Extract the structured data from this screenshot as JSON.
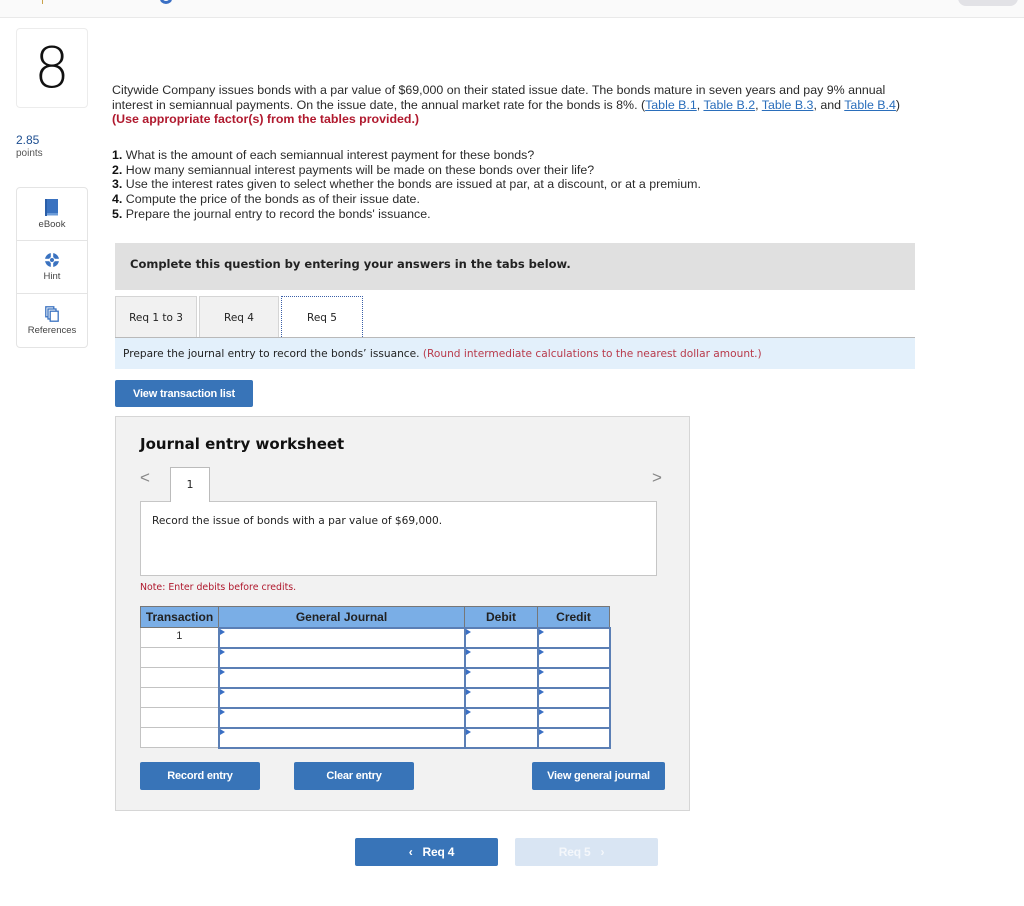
{
  "question": {
    "number": "8",
    "points_value": "2.85",
    "points_label": "points"
  },
  "tools": [
    {
      "icon": "book-icon",
      "label": "eBook"
    },
    {
      "icon": "lifebuoy-icon",
      "label": "Hint"
    },
    {
      "icon": "copy-pages-icon",
      "label": "References"
    }
  ],
  "problem": {
    "text_part1": "Citywide Company issues bonds with a par value of $69,000 on their stated issue date. The bonds mature in seven years and pay 9% annual interest in semiannual payments. On the issue date, the annual market rate for the bonds is 8%. (",
    "links": [
      "Table B.1",
      "Table B.2",
      "Table B.3",
      "Table B.4"
    ],
    "sep_comma": ", ",
    "sep_and": ", and ",
    "close_paren": ") ",
    "instruction": "(Use appropriate factor(s) from the tables provided.)"
  },
  "questions": [
    {
      "num": "1.",
      "text": " What is the amount of each semiannual interest payment for these bonds?"
    },
    {
      "num": "2.",
      "text": " How many semiannual interest payments will be made on these bonds over their life?"
    },
    {
      "num": "3.",
      "text": " Use the interest rates given to select whether the bonds are issued at par, at a discount, or at a premium."
    },
    {
      "num": "4.",
      "text": " Compute the price of the bonds as of their issue date."
    },
    {
      "num": "5.",
      "text": " Prepare the journal entry to record the bonds' issuance."
    }
  ],
  "complete_banner": "Complete this question by entering your answers in the tabs below.",
  "tabs": [
    {
      "label": "Req 1 to 3",
      "active": false
    },
    {
      "label": "Req 4",
      "active": false
    },
    {
      "label": "Req 5",
      "active": true
    }
  ],
  "instruction": {
    "text": "Prepare the journal entry to record the bonds’ issuance. ",
    "note": "(Round intermediate calculations to the nearest dollar amount.)"
  },
  "view_transaction_list": "View transaction list",
  "worksheet": {
    "title": "Journal entry worksheet",
    "prev": "<",
    "next": ">",
    "current_tab": "1",
    "description": "Record the issue of bonds with a par value of $69,000.",
    "note": "Note: Enter debits before credits.",
    "columns": [
      "Transaction",
      "General Journal",
      "Debit",
      "Credit"
    ],
    "rows": [
      {
        "transaction": "1",
        "account": "",
        "debit": "",
        "credit": ""
      },
      {
        "transaction": "",
        "account": "",
        "debit": "",
        "credit": ""
      },
      {
        "transaction": "",
        "account": "",
        "debit": "",
        "credit": ""
      },
      {
        "transaction": "",
        "account": "",
        "debit": "",
        "credit": ""
      },
      {
        "transaction": "",
        "account": "",
        "debit": "",
        "credit": ""
      },
      {
        "transaction": "",
        "account": "",
        "debit": "",
        "credit": ""
      }
    ],
    "buttons": {
      "record": "Record entry",
      "clear": "Clear entry",
      "view_journal": "View general journal"
    }
  },
  "nav": {
    "prev_label": "Req 4",
    "next_label": "Req 5",
    "prev_chevron": "‹",
    "next_chevron": "›"
  },
  "colors": {
    "primary_button": "#3874b8",
    "disabled_button": "#d9e5f3",
    "table_header": "#7aaee6",
    "instruction_bg": "#e3f0fb",
    "alert_red": "#b0192e",
    "link_blue": "#2a6ebb"
  }
}
